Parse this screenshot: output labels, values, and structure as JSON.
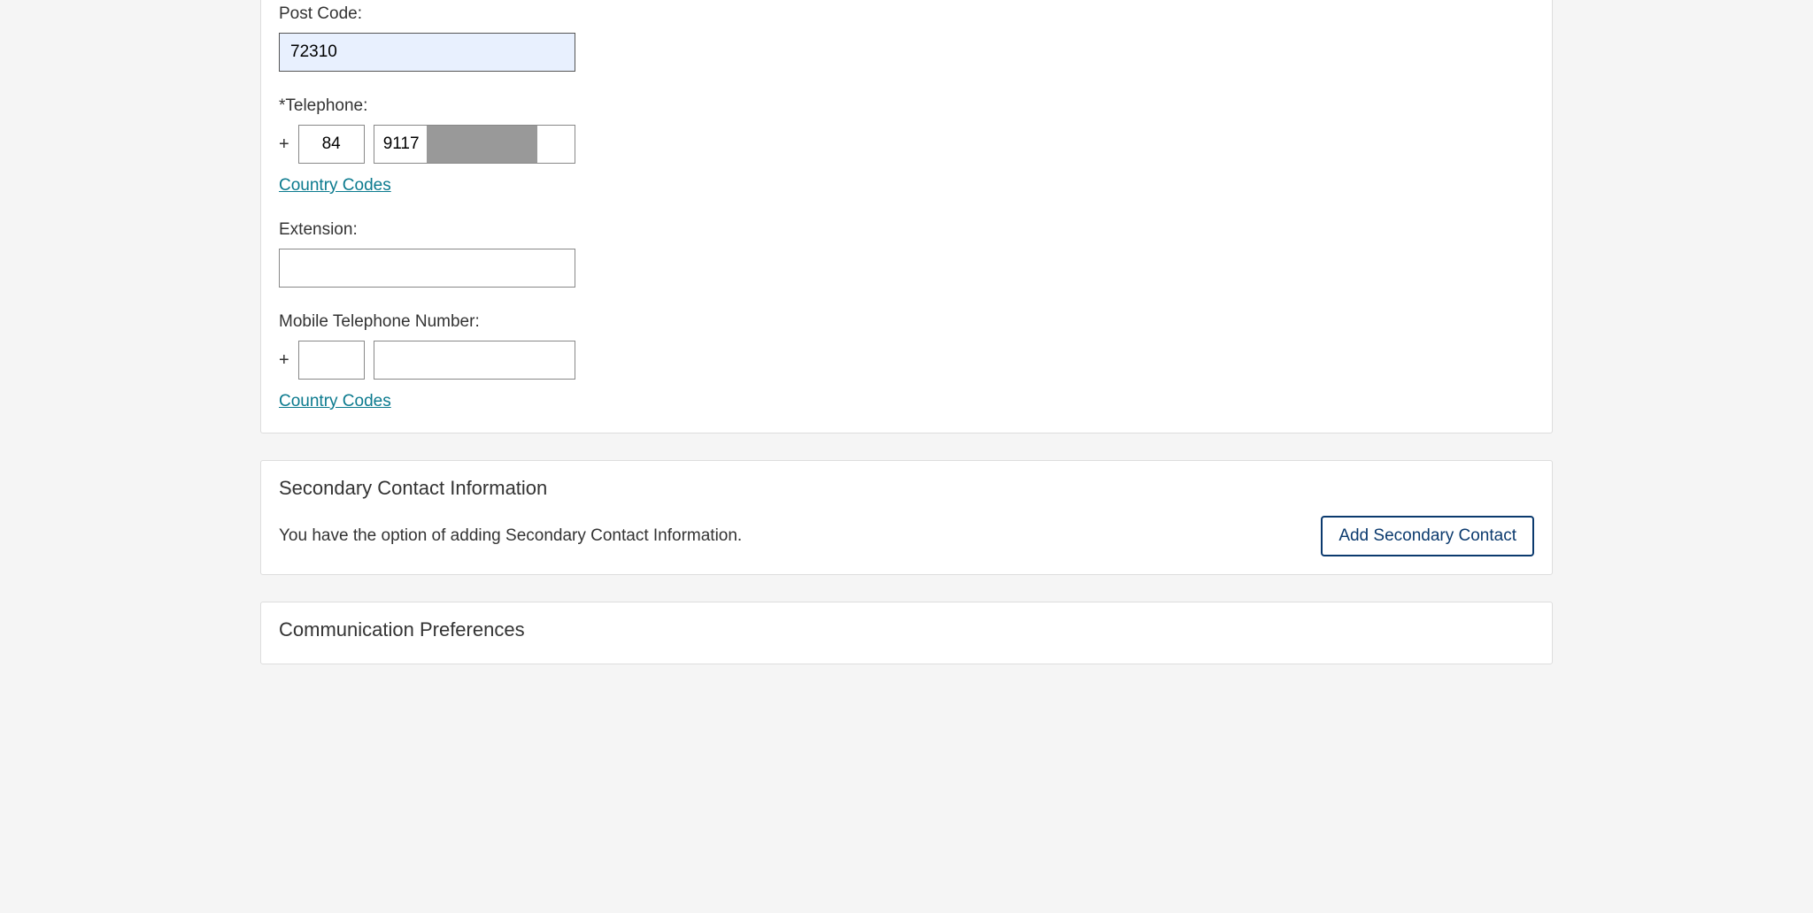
{
  "primary": {
    "postcode_label": "Post Code:",
    "postcode_value": "72310",
    "telephone_label": "*Telephone:",
    "plus": "+",
    "tel_country_code": "84",
    "tel_number": "9117",
    "country_codes_link": "Country Codes",
    "extension_label": "Extension:",
    "extension_value": "",
    "mobile_label": "Mobile Telephone Number:",
    "mobile_country_code": "",
    "mobile_number": ""
  },
  "secondary": {
    "heading": "Secondary Contact Information",
    "description": "You have the option of adding Secondary Contact Information.",
    "button_label": "Add Secondary Contact"
  },
  "comms": {
    "heading": "Communication Preferences"
  }
}
